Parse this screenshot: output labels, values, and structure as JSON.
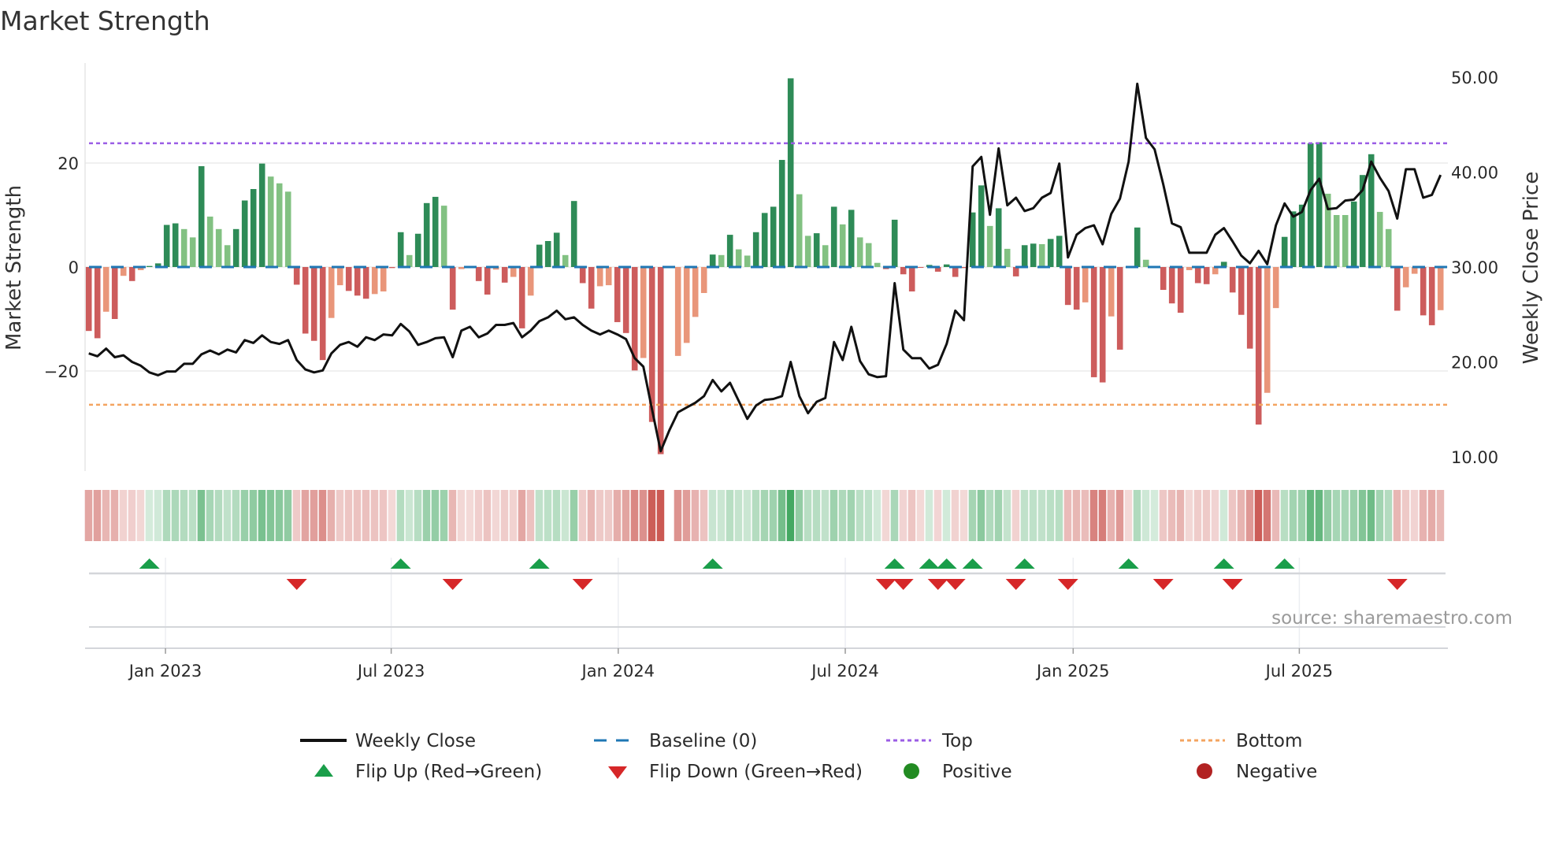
{
  "chart_data": {
    "type": "bar",
    "title": "Market Strength",
    "ylabel": "Market Strength",
    "y2label": "Weekly Close Price",
    "ylim": [
      -36,
      36
    ],
    "y2lim": [
      10,
      50
    ],
    "yticks": [
      {
        "v": 20,
        "label": "20"
      },
      {
        "v": 0,
        "label": "0"
      },
      {
        "v": -20,
        "label": "−20"
      }
    ],
    "y2ticks": [
      {
        "v": 50,
        "label": "50.00"
      },
      {
        "v": 40,
        "label": "40.00"
      },
      {
        "v": 30,
        "label": "30.00"
      },
      {
        "v": 20,
        "label": "20.00"
      },
      {
        "v": 10,
        "label": "10.00"
      }
    ],
    "xticks": [
      {
        "week": 9.85,
        "label": "Jan 2023"
      },
      {
        "week": 35.9,
        "label": "Jul 2023"
      },
      {
        "week": 62.1,
        "label": "Jan 2024"
      },
      {
        "week": 88.3,
        "label": "Jul 2024"
      },
      {
        "week": 114.6,
        "label": "Jan 2025"
      },
      {
        "week": 140.7,
        "label": "Jul 2025"
      }
    ],
    "top_level": 23.8,
    "bottom_level": -26.5,
    "baseline": 0,
    "strength": [
      -12.3,
      -13.7,
      -8.6,
      -10,
      -1.7,
      -2.7,
      -0.6,
      0.2,
      0.7,
      8.1,
      8.4,
      7.3,
      5.7,
      19.4,
      9.7,
      7.3,
      4.2,
      7.3,
      12.8,
      15,
      19.9,
      17.4,
      16.1,
      14.5,
      -3.4,
      -12.8,
      -14.2,
      -17.9,
      -9.8,
      -3.5,
      -4.6,
      -5.5,
      -6.1,
      -5.2,
      -4.7,
      -0.2,
      6.7,
      2.3,
      6.4,
      12.3,
      13.5,
      11.8,
      -8.2,
      -0.4,
      -0.1,
      -2.7,
      -5.3,
      -0.5,
      -3,
      -1.9,
      -11.8,
      -5.5,
      4.3,
      5,
      6.6,
      2.3,
      12.7,
      -3.1,
      -8,
      -3.7,
      -3.5,
      -10.6,
      -12.7,
      -19.9,
      -17.5,
      -29.8,
      -36,
      0,
      -17.1,
      -14.6,
      -9.6,
      -5,
      2.4,
      2.3,
      6.2,
      3.4,
      2.2,
      6.7,
      10.4,
      11.6,
      20.6,
      36.3,
      14,
      6,
      6.5,
      4.2,
      11.6,
      8.2,
      11,
      5.7,
      4.6,
      0.8,
      -0.4,
      9.1,
      -1.4,
      -4.7,
      -0.1,
      0.4,
      -0.9,
      0.5,
      -1.9,
      -0.2,
      10.5,
      15.7,
      7.9,
      11.3,
      3.5,
      -1.8,
      4.2,
      4.5,
      4.4,
      5.4,
      6,
      -7.3,
      -8.2,
      -6.8,
      -21.2,
      -22.2,
      -9.5,
      -15.9,
      -0.1,
      7.6,
      1.4,
      0.1,
      -4.4,
      -7,
      -8.8,
      -0.6,
      -3.1,
      -3.3,
      -1.4,
      1,
      -4.9,
      -9.2,
      -15.7,
      -30.3,
      -24.2,
      -7.9,
      5.8,
      10.7,
      12,
      23.8,
      24,
      14.1,
      10,
      10,
      12.6,
      17.7,
      21.7,
      10.6,
      7.3,
      -8.4,
      -3.9,
      -1.3,
      -9.3,
      -11.2,
      -8.3
    ],
    "weakening_weeks": [
      3,
      5,
      7,
      12,
      13,
      15,
      16,
      17,
      22,
      23,
      24,
      29,
      30,
      34,
      35,
      38,
      42,
      44,
      48,
      50,
      52,
      56,
      60,
      61,
      65,
      69,
      70,
      71,
      72,
      74,
      76,
      77,
      83,
      84,
      86,
      88,
      90,
      91,
      92,
      105,
      107,
      111,
      116,
      119,
      123,
      124,
      128,
      131,
      137,
      138,
      144,
      145,
      146,
      150,
      151,
      153,
      154,
      157
    ],
    "weekly_close": [
      20.9,
      20.6,
      21.4,
      20.5,
      20.7,
      20,
      19.6,
      18.9,
      18.6,
      19,
      19,
      19.8,
      19.8,
      20.8,
      21.2,
      20.8,
      21.3,
      21,
      22.3,
      22,
      22.8,
      22.1,
      21.9,
      22.3,
      20.2,
      19.2,
      18.9,
      19.1,
      20.9,
      21.8,
      22.1,
      21.6,
      22.6,
      22.3,
      22.9,
      22.8,
      24,
      23.2,
      21.8,
      22.1,
      22.5,
      22.6,
      20.5,
      23.3,
      23.7,
      22.6,
      23,
      23.9,
      23.9,
      24.1,
      22.6,
      23.3,
      24.3,
      24.7,
      25.4,
      24.5,
      24.7,
      23.9,
      23.3,
      22.9,
      23.3,
      22.9,
      22.4,
      20.4,
      19.5,
      15,
      10.6,
      12.8,
      14.7,
      15.2,
      15.7,
      16.4,
      18.1,
      16.9,
      17.8,
      15.9,
      14,
      15.4,
      16,
      16.1,
      16.4,
      20,
      16.4,
      14.6,
      15.8,
      16.2,
      22.1,
      20.2,
      23.7,
      20.1,
      18.7,
      18.4,
      18.5,
      28.3,
      21.3,
      20.4,
      20.4,
      19.3,
      19.7,
      21.9,
      25.4,
      24.4,
      40.6,
      41.6,
      35.5,
      42.5,
      36.5,
      37.3,
      35.9,
      36.2,
      37.3,
      37.8,
      40.9,
      31,
      33.4,
      34.1,
      34.4,
      32.4,
      35.6,
      37.2,
      41.1,
      49.3,
      43.6,
      42.4,
      38.7,
      34.6,
      34.2,
      31.5,
      31.5,
      31.5,
      33.4,
      34.1,
      32.7,
      31.2,
      30.4,
      31.7,
      30.3,
      34.4,
      36.7,
      35.3,
      35.8,
      38.1,
      39.3,
      36.1,
      36.2,
      37,
      37.1,
      38.1,
      41.1,
      39.4,
      38,
      35.1,
      40.3,
      40.3,
      37.3,
      37.6,
      39.7
    ],
    "flip_up_weeks": [
      8,
      37,
      53,
      73,
      94,
      98,
      100,
      103,
      109,
      121,
      132,
      139
    ],
    "flip_down_weeks": [
      25,
      43,
      58,
      93,
      95,
      99,
      101,
      108,
      114,
      125,
      133,
      152
    ],
    "colors": {
      "strong_positive": "#2e8b57",
      "weak_positive": "#82c182",
      "strong_negative": "#cd5c5c",
      "weak_negative": "#e9967a",
      "baseline": "#1f77b4",
      "top": "#9b5de5",
      "bottom": "#f4a460",
      "close": "#111111",
      "flip_up": "#1a9e4a",
      "flip_down": "#d62728",
      "positive": "#228b22",
      "negative": "#b22222"
    },
    "legend": {
      "weekly_close": "Weekly Close",
      "baseline": "Baseline (0)",
      "top": "Top",
      "bottom": "Bottom",
      "flip_up": "Flip Up (Red→Green)",
      "flip_down": "Flip Down (Green→Red)",
      "positive": "Positive",
      "negative": "Negative"
    },
    "source": "source: sharemaestro.com"
  }
}
